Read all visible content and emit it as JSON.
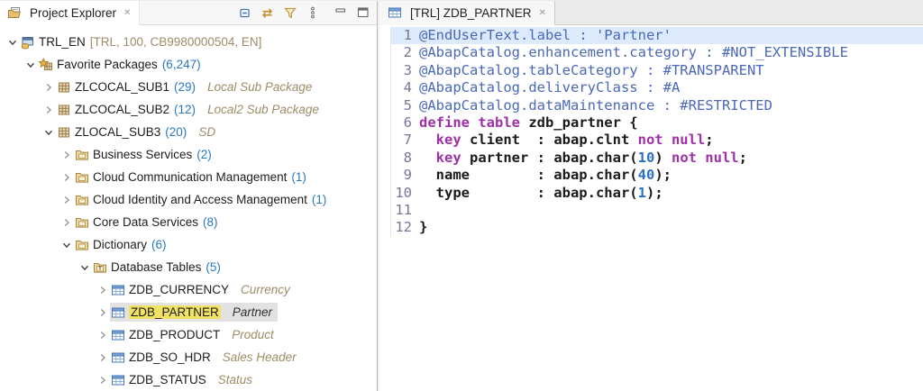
{
  "colors": {
    "count_blue": "#2878c0",
    "description_tan": "#9d8c66",
    "selection_bg": "#e2e2e2",
    "occurrence_highlight_yellow": "#f2e264",
    "current_line_bg": "#dceafb",
    "annotation_blue": "#4a68b8",
    "keyword_purple": "#9e30a8",
    "number_blue": "#2a6fc9"
  },
  "project_explorer": {
    "tab_label": "Project Explorer",
    "close_glyph": "✕",
    "toolbar": [
      {
        "name": "collapse-all-icon"
      },
      {
        "name": "link-with-editor-icon"
      },
      {
        "name": "filter-icon"
      },
      {
        "name": "view-menu-icon"
      },
      {
        "name": "minimize-icon"
      },
      {
        "name": "maximize-icon"
      }
    ],
    "tree": [
      {
        "level": 0,
        "state": "expanded",
        "icon": "abap-project",
        "label": "TRL_EN",
        "suffix": "[TRL, 100, CB9980000504, EN]"
      },
      {
        "level": 1,
        "state": "expanded",
        "icon": "favorite-packages",
        "label": "Favorite Packages",
        "count": "(6,247)"
      },
      {
        "level": 2,
        "state": "collapsed",
        "icon": "package",
        "label": "ZLCOCAL_SUB1",
        "count": "(29)",
        "desc": "Local Sub Package"
      },
      {
        "level": 2,
        "state": "collapsed",
        "icon": "package",
        "label": "ZLCOCAL_SUB2",
        "count": "(12)",
        "desc": "Local2 Sub Package"
      },
      {
        "level": 2,
        "state": "expanded",
        "icon": "package",
        "label": "ZLOCAL_SUB3",
        "count": "(20)",
        "desc": "SD"
      },
      {
        "level": 3,
        "state": "collapsed",
        "icon": "group-folder",
        "label": "Business Services",
        "count": "(2)"
      },
      {
        "level": 3,
        "state": "collapsed",
        "icon": "group-folder",
        "label": "Cloud Communication Management",
        "count": "(1)"
      },
      {
        "level": 3,
        "state": "collapsed",
        "icon": "group-folder",
        "label": "Cloud Identity and Access Management",
        "count": "(1)"
      },
      {
        "level": 3,
        "state": "collapsed",
        "icon": "group-folder",
        "label": "Core Data Services",
        "count": "(8)"
      },
      {
        "level": 3,
        "state": "expanded",
        "icon": "group-folder",
        "label": "Dictionary",
        "count": "(6)"
      },
      {
        "level": 4,
        "state": "expanded",
        "icon": "tables-folder",
        "label": "Database Tables",
        "count": "(5)"
      },
      {
        "level": 5,
        "state": "collapsed",
        "icon": "db-table",
        "label": "ZDB_CURRENCY",
        "desc": "Currency"
      },
      {
        "level": 5,
        "state": "collapsed",
        "icon": "db-table",
        "label": "ZDB_PARTNER",
        "desc": "Partner",
        "selected": true,
        "highlighted": true
      },
      {
        "level": 5,
        "state": "collapsed",
        "icon": "db-table",
        "label": "ZDB_PRODUCT",
        "desc": "Product"
      },
      {
        "level": 5,
        "state": "collapsed",
        "icon": "db-table",
        "label": "ZDB_SO_HDR",
        "desc": "Sales Header"
      },
      {
        "level": 5,
        "state": "collapsed",
        "icon": "db-table",
        "label": "ZDB_STATUS",
        "desc": "Status"
      }
    ]
  },
  "editor": {
    "tab_label": "[TRL] ZDB_PARTNER",
    "close_glyph": "✕",
    "lines": [
      {
        "n": "1",
        "current": true,
        "segs": [
          [
            "ann",
            "@EndUserText.label : 'Partner'"
          ]
        ]
      },
      {
        "n": "2",
        "segs": [
          [
            "ann",
            "@AbapCatalog.enhancement.category : #NOT_EXTENSIBLE"
          ]
        ]
      },
      {
        "n": "3",
        "segs": [
          [
            "ann",
            "@AbapCatalog.tableCategory : #TRANSPARENT"
          ]
        ]
      },
      {
        "n": "4",
        "segs": [
          [
            "ann",
            "@AbapCatalog.deliveryClass : #A"
          ]
        ]
      },
      {
        "n": "5",
        "segs": [
          [
            "ann",
            "@AbapCatalog.dataMaintenance : #RESTRICTED"
          ]
        ]
      },
      {
        "n": "6",
        "segs": [
          [
            "kw",
            "define table"
          ],
          [
            "id",
            " zdb_partner {"
          ]
        ]
      },
      {
        "n": "7",
        "segs": [
          [
            "id",
            "  "
          ],
          [
            "kw",
            "key"
          ],
          [
            "id",
            " client  : abap.clnt "
          ],
          [
            "kw",
            "not null"
          ],
          [
            "id",
            ";"
          ]
        ]
      },
      {
        "n": "8",
        "segs": [
          [
            "id",
            "  "
          ],
          [
            "kw",
            "key"
          ],
          [
            "id",
            " partner : abap.char("
          ],
          [
            "num",
            "10"
          ],
          [
            "id",
            ") "
          ],
          [
            "kw",
            "not null"
          ],
          [
            "id",
            ";"
          ]
        ]
      },
      {
        "n": "9",
        "segs": [
          [
            "id",
            "  name        : abap.char("
          ],
          [
            "num",
            "40"
          ],
          [
            "id",
            ");"
          ]
        ]
      },
      {
        "n": "10",
        "segs": [
          [
            "id",
            "  type        : abap.char("
          ],
          [
            "num",
            "1"
          ],
          [
            "id",
            ");"
          ]
        ]
      },
      {
        "n": "11",
        "segs": []
      },
      {
        "n": "12",
        "segs": [
          [
            "id",
            "}"
          ]
        ]
      }
    ]
  }
}
